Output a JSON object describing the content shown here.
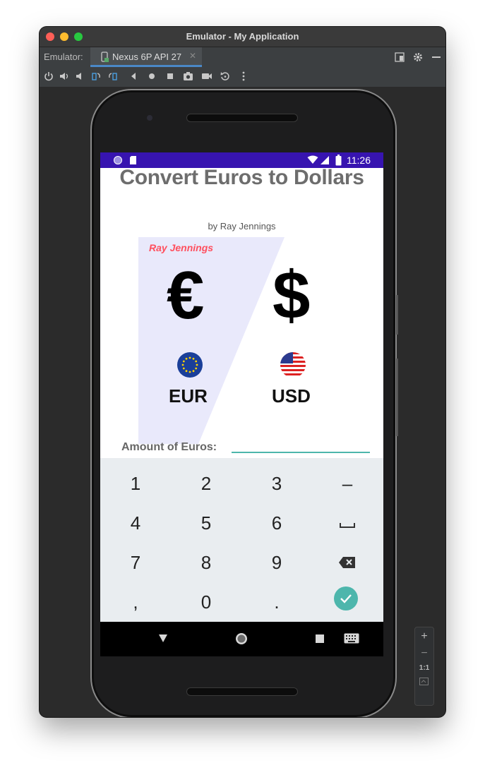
{
  "window": {
    "title": "Emulator - My Application",
    "emulator_label": "Emulator:",
    "device_tab": "Nexus 6P API 27"
  },
  "status_bar": {
    "time": "11:26"
  },
  "app": {
    "title": "Convert Euros to Dollars",
    "subtitle": "by Ray Jennings",
    "graphic": {
      "signature": "Ray Jennings",
      "euro_symbol": "€",
      "dollar_symbol": "$",
      "eur_label": "EUR",
      "usd_label": "USD"
    },
    "amount_label": "Amount of Euros:",
    "amount_value": ""
  },
  "keypad": {
    "rows": [
      [
        "1",
        "2",
        "3",
        "–"
      ],
      [
        "4",
        "5",
        "6",
        "␣"
      ],
      [
        "7",
        "8",
        "9",
        "⌫"
      ],
      [
        ",",
        "0",
        ".",
        "✓"
      ]
    ]
  },
  "side_panel": {
    "zoom_in": "+",
    "zoom_out": "−",
    "one_to_one": "1:1"
  },
  "colors": {
    "status_bar": "#3714b0",
    "accent_teal": "#4db6ac",
    "keypad_bg": "#e9edf0",
    "signature_red": "#ff4f5e",
    "graphic_panel": "#e9e9fb"
  },
  "icons": {
    "toolbar": [
      "power-icon",
      "volume-up-icon",
      "volume-down-icon",
      "rotate-left-icon",
      "rotate-right-icon",
      "back-icon",
      "home-icon",
      "overview-icon",
      "camera-icon",
      "video-icon",
      "replay-icon",
      "more-icon"
    ],
    "nav": [
      "back-triangle-icon",
      "home-circle-icon",
      "recents-square-icon",
      "keyboard-icon"
    ]
  }
}
